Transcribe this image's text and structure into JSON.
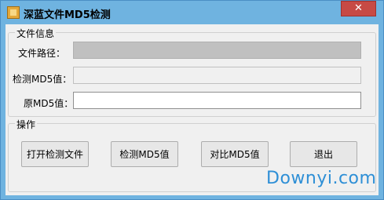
{
  "window": {
    "title": "深蓝文件MD5检测",
    "close_glyph": "✕"
  },
  "file_info": {
    "legend": "文件信息",
    "path_label": "文件路径：",
    "path_value": "",
    "detected_label": "检测MD5值：",
    "detected_value": "",
    "original_label": "原MD5值：",
    "original_value": ""
  },
  "operations": {
    "legend": "操作",
    "open_label": "打开检测文件",
    "detect_label": "检测MD5值",
    "compare_label": "对比MD5值",
    "exit_label": "退出"
  },
  "watermark": "Downyi.com"
}
